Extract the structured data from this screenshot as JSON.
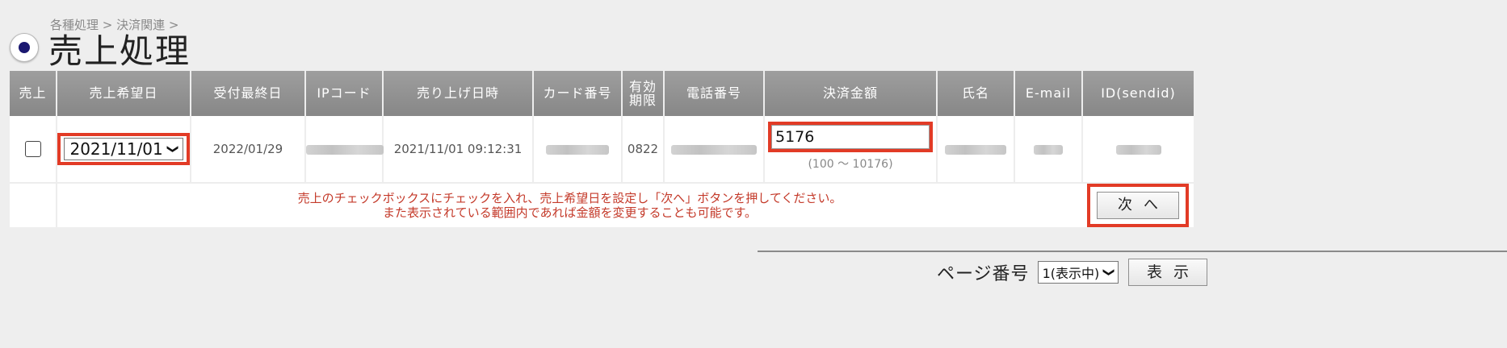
{
  "breadcrumb": "各種処理 > 決済関連 >",
  "page_title": "売上処理",
  "table": {
    "headers": [
      "売上",
      "売上希望日",
      "受付最終日",
      "IPコード",
      "売り上げ日時",
      "カード番号",
      "有効\n期限",
      "電話番号",
      "決済金額",
      "氏名",
      "E-mail",
      "ID(sendid)"
    ],
    "row": {
      "desired_date": "2021/11/01",
      "deadline": "2022/01/29",
      "sale_datetime": "2021/11/01 09:12:31",
      "expiry": "0822",
      "amount": "5176",
      "amount_range": "(100 ～ 10176)"
    },
    "message_line1": "売上のチェックボックスにチェックを入れ、売上希望日を設定し「次へ」ボタンを押してください。",
    "message_line2": "また表示されている範囲内であれば金額を変更することも可能です。",
    "next_button": "次へ"
  },
  "pager": {
    "label": "ページ番号",
    "selected": "1(表示中)",
    "show_button": "表示"
  },
  "colors": {
    "highlight": "#e23b26",
    "header_bg": "#929292",
    "message_text": "#c43a2a"
  }
}
